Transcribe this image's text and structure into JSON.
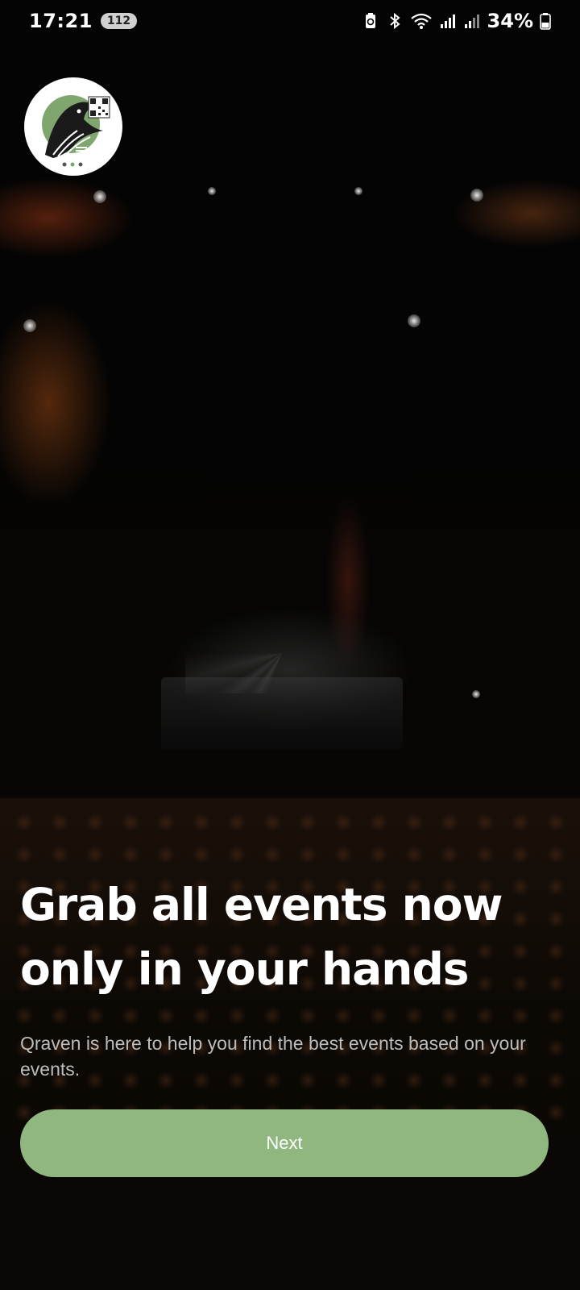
{
  "status_bar": {
    "time": "17:21",
    "notification_count": "112",
    "battery_percent": "34%",
    "icons": [
      "battery-saver-icon",
      "bluetooth-icon",
      "wifi-icon",
      "signal-icon",
      "signal-icon",
      "battery-icon"
    ]
  },
  "logo": {
    "icon": "raven-qr-logo-icon",
    "accent_color": "#7fa66f"
  },
  "onboarding": {
    "headline": "Grab all events now only in your hands",
    "description": "Qraven is here to help you find the best events based on your events.",
    "next_label": "Next"
  },
  "colors": {
    "button": "#8fb77f",
    "background": "#000000",
    "subtext": "#bdbdbd"
  }
}
